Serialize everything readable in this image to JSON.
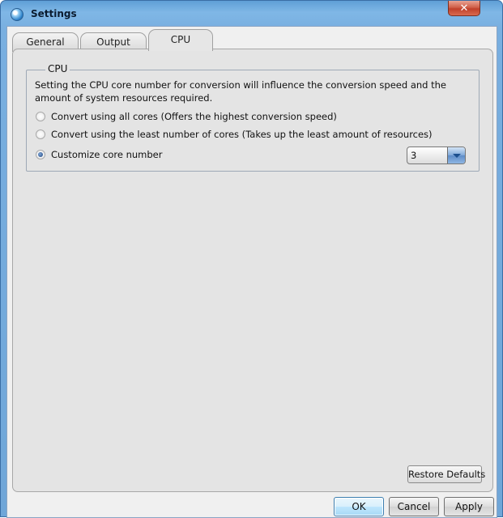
{
  "window": {
    "title": "Settings",
    "app_icon": "globe-icon"
  },
  "titlebar": {
    "close_label": "✕"
  },
  "tabs": [
    {
      "label": "General",
      "active": false
    },
    {
      "label": "Output",
      "active": false
    },
    {
      "label": "CPU",
      "active": true
    }
  ],
  "cpu": {
    "group_label": "CPU",
    "description": "Setting the CPU core number for conversion will influence the conversion speed and the amount of system resources required.",
    "options": [
      {
        "label": "Convert using all cores (Offers the highest conversion speed)",
        "checked": false
      },
      {
        "label": "Convert using the least number of cores (Takes up the least amount of resources)",
        "checked": false
      },
      {
        "label": "Customize core number",
        "checked": true
      }
    ],
    "core_number": "3"
  },
  "restore_defaults": "Restore Defaults",
  "buttons": {
    "ok": "OK",
    "cancel": "Cancel",
    "apply": "Apply"
  },
  "colors": {
    "accent": "#3c7fb1",
    "titlebar": "#79afe0",
    "close": "#c1402a"
  }
}
